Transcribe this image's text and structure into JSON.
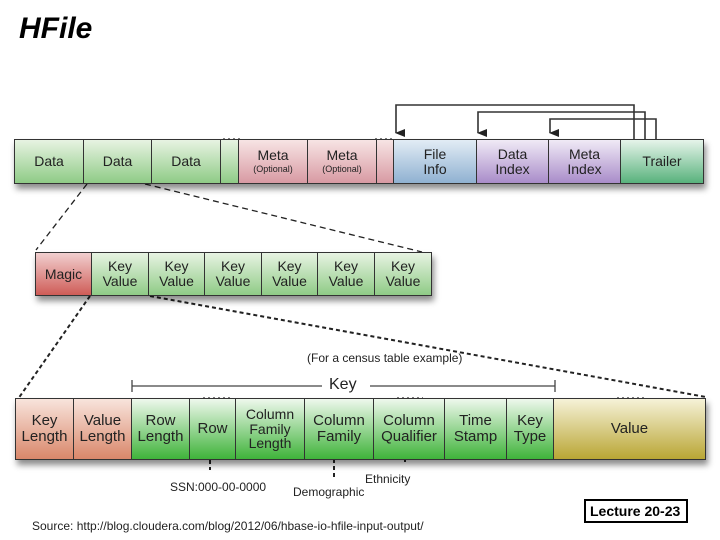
{
  "title": "HFile",
  "hfile_row": {
    "cells": [
      {
        "label": "Data",
        "sub": "",
        "kind": "data"
      },
      {
        "label": "Data",
        "sub": "",
        "kind": "data"
      },
      {
        "label": "Data",
        "sub": "",
        "kind": "data"
      },
      {
        "label": "Meta",
        "sub": "(Optional)",
        "kind": "meta"
      },
      {
        "label": "Meta",
        "sub": "(Optional)",
        "kind": "meta"
      },
      {
        "label": "File Info",
        "sub": "",
        "kind": "fileinfo"
      },
      {
        "label": "Data Index",
        "sub": "",
        "kind": "index"
      },
      {
        "label": "Meta Index",
        "sub": "",
        "kind": "index"
      },
      {
        "label": "Trailer",
        "sub": "",
        "kind": "trailer"
      }
    ]
  },
  "data_block_row": {
    "cells": [
      "Magic",
      "Key Value",
      "Key Value",
      "Key Value",
      "Key Value",
      "Key Value",
      "Key Value"
    ]
  },
  "keyvalue_row": {
    "caption": "(For a census table example)",
    "key_span_label": "Key",
    "cells": [
      "Key Length",
      "Value Length",
      "Row Length",
      "Row",
      "Column Family Length",
      "Column Family",
      "Column Qualifier",
      "Time Stamp",
      "Key Type",
      "Value"
    ]
  },
  "annotations": {
    "row": "SSN:000-00-0000",
    "column_family": "Demographic",
    "column_qualifier": "Ethnicity"
  },
  "source": "Source: http://blog.cloudera.com/blog/2012/06/hbase-io-hfile-input-output/",
  "lecture": "Lecture 20-23",
  "colors": {
    "data": "#8fcb86",
    "meta": "#d89aa3",
    "file_info": "#8fb1d1",
    "index": "#a98cc9",
    "trailer": "#58b27c",
    "magic": "#cf5c57",
    "length": "#d9876a",
    "key": "#3fb33a",
    "value": "#b9a634"
  }
}
